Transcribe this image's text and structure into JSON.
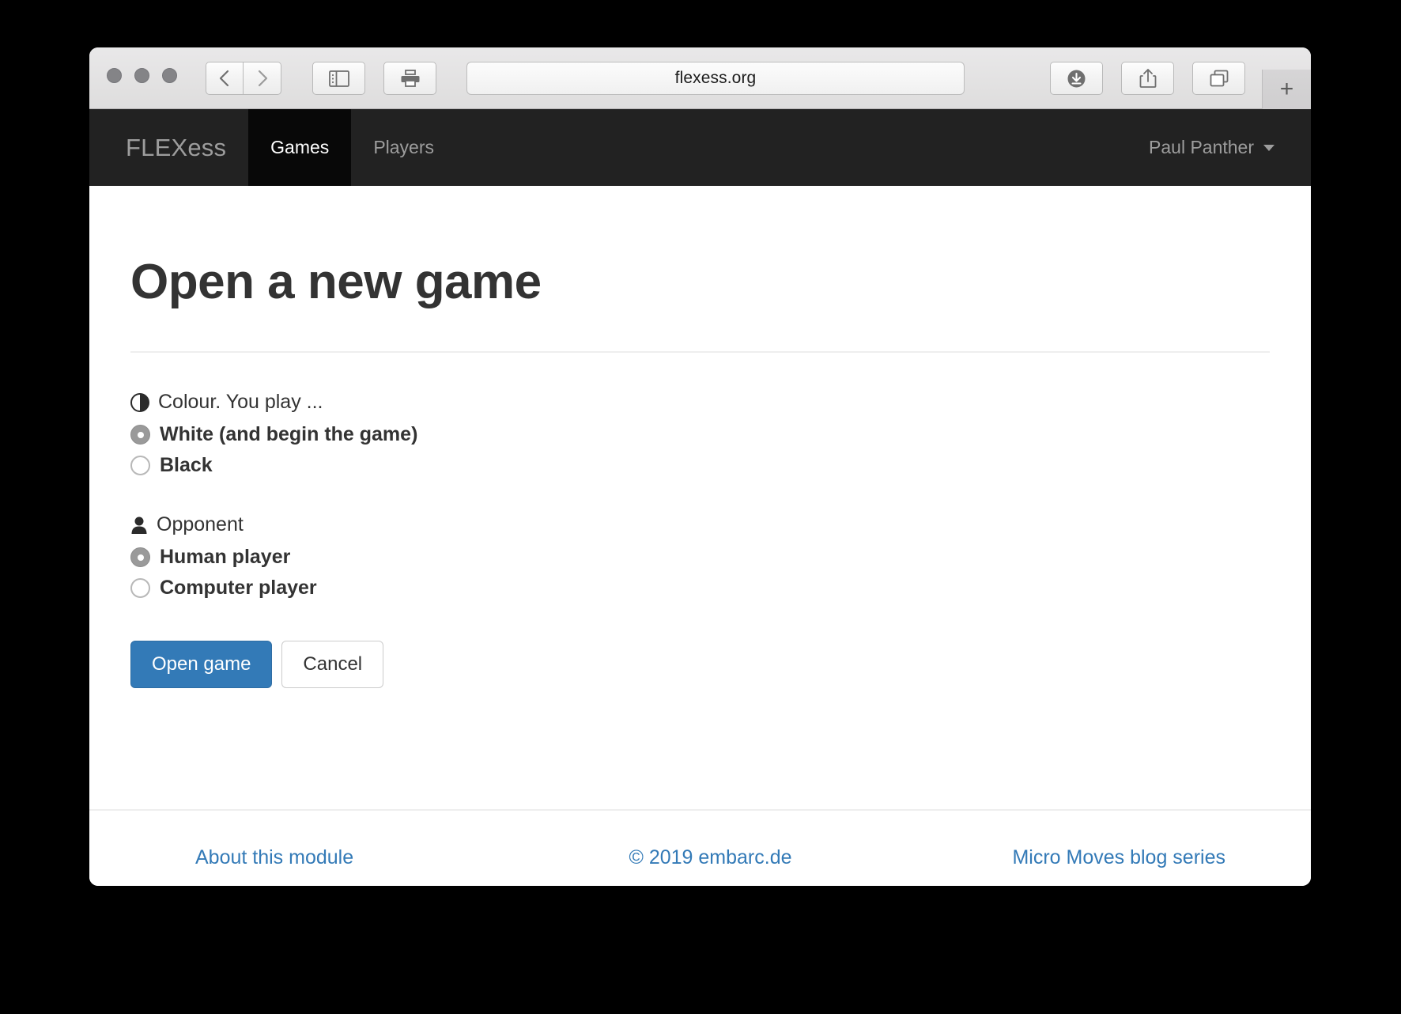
{
  "browser": {
    "url": "flexess.org",
    "traffic_lights": [
      "close",
      "minimize",
      "maximize"
    ],
    "toolbar_icons": {
      "back": "chevron-left-icon",
      "forward": "chevron-right-icon",
      "sidebar": "sidebar-icon",
      "print": "print-icon",
      "download": "download-icon",
      "share": "share-icon",
      "tabs": "tab-overview-icon",
      "new_tab": "+"
    }
  },
  "navbar": {
    "brand": "FLEXess",
    "items": [
      {
        "label": "Games",
        "active": true
      },
      {
        "label": "Players",
        "active": false
      }
    ],
    "user": "Paul Panther"
  },
  "page": {
    "title": "Open a new game"
  },
  "form": {
    "colour": {
      "icon": "contrast-icon",
      "legend": "Colour. You play ...",
      "options": [
        {
          "label": "White (and begin the game)",
          "checked": true
        },
        {
          "label": "Black",
          "checked": false
        }
      ]
    },
    "opponent": {
      "icon": "person-icon",
      "legend": "Opponent",
      "options": [
        {
          "label": "Human player",
          "checked": true
        },
        {
          "label": "Computer player",
          "checked": false
        }
      ]
    },
    "submit_label": "Open game",
    "cancel_label": "Cancel"
  },
  "footer": {
    "left": "About this module",
    "center": "© 2019 embarc.de",
    "right": "Micro Moves blog series"
  },
  "colors": {
    "primary": "#337ab7",
    "navbar_bg": "#222222",
    "navbar_active_bg": "#080808",
    "link": "#337ab7",
    "text": "#333333"
  }
}
